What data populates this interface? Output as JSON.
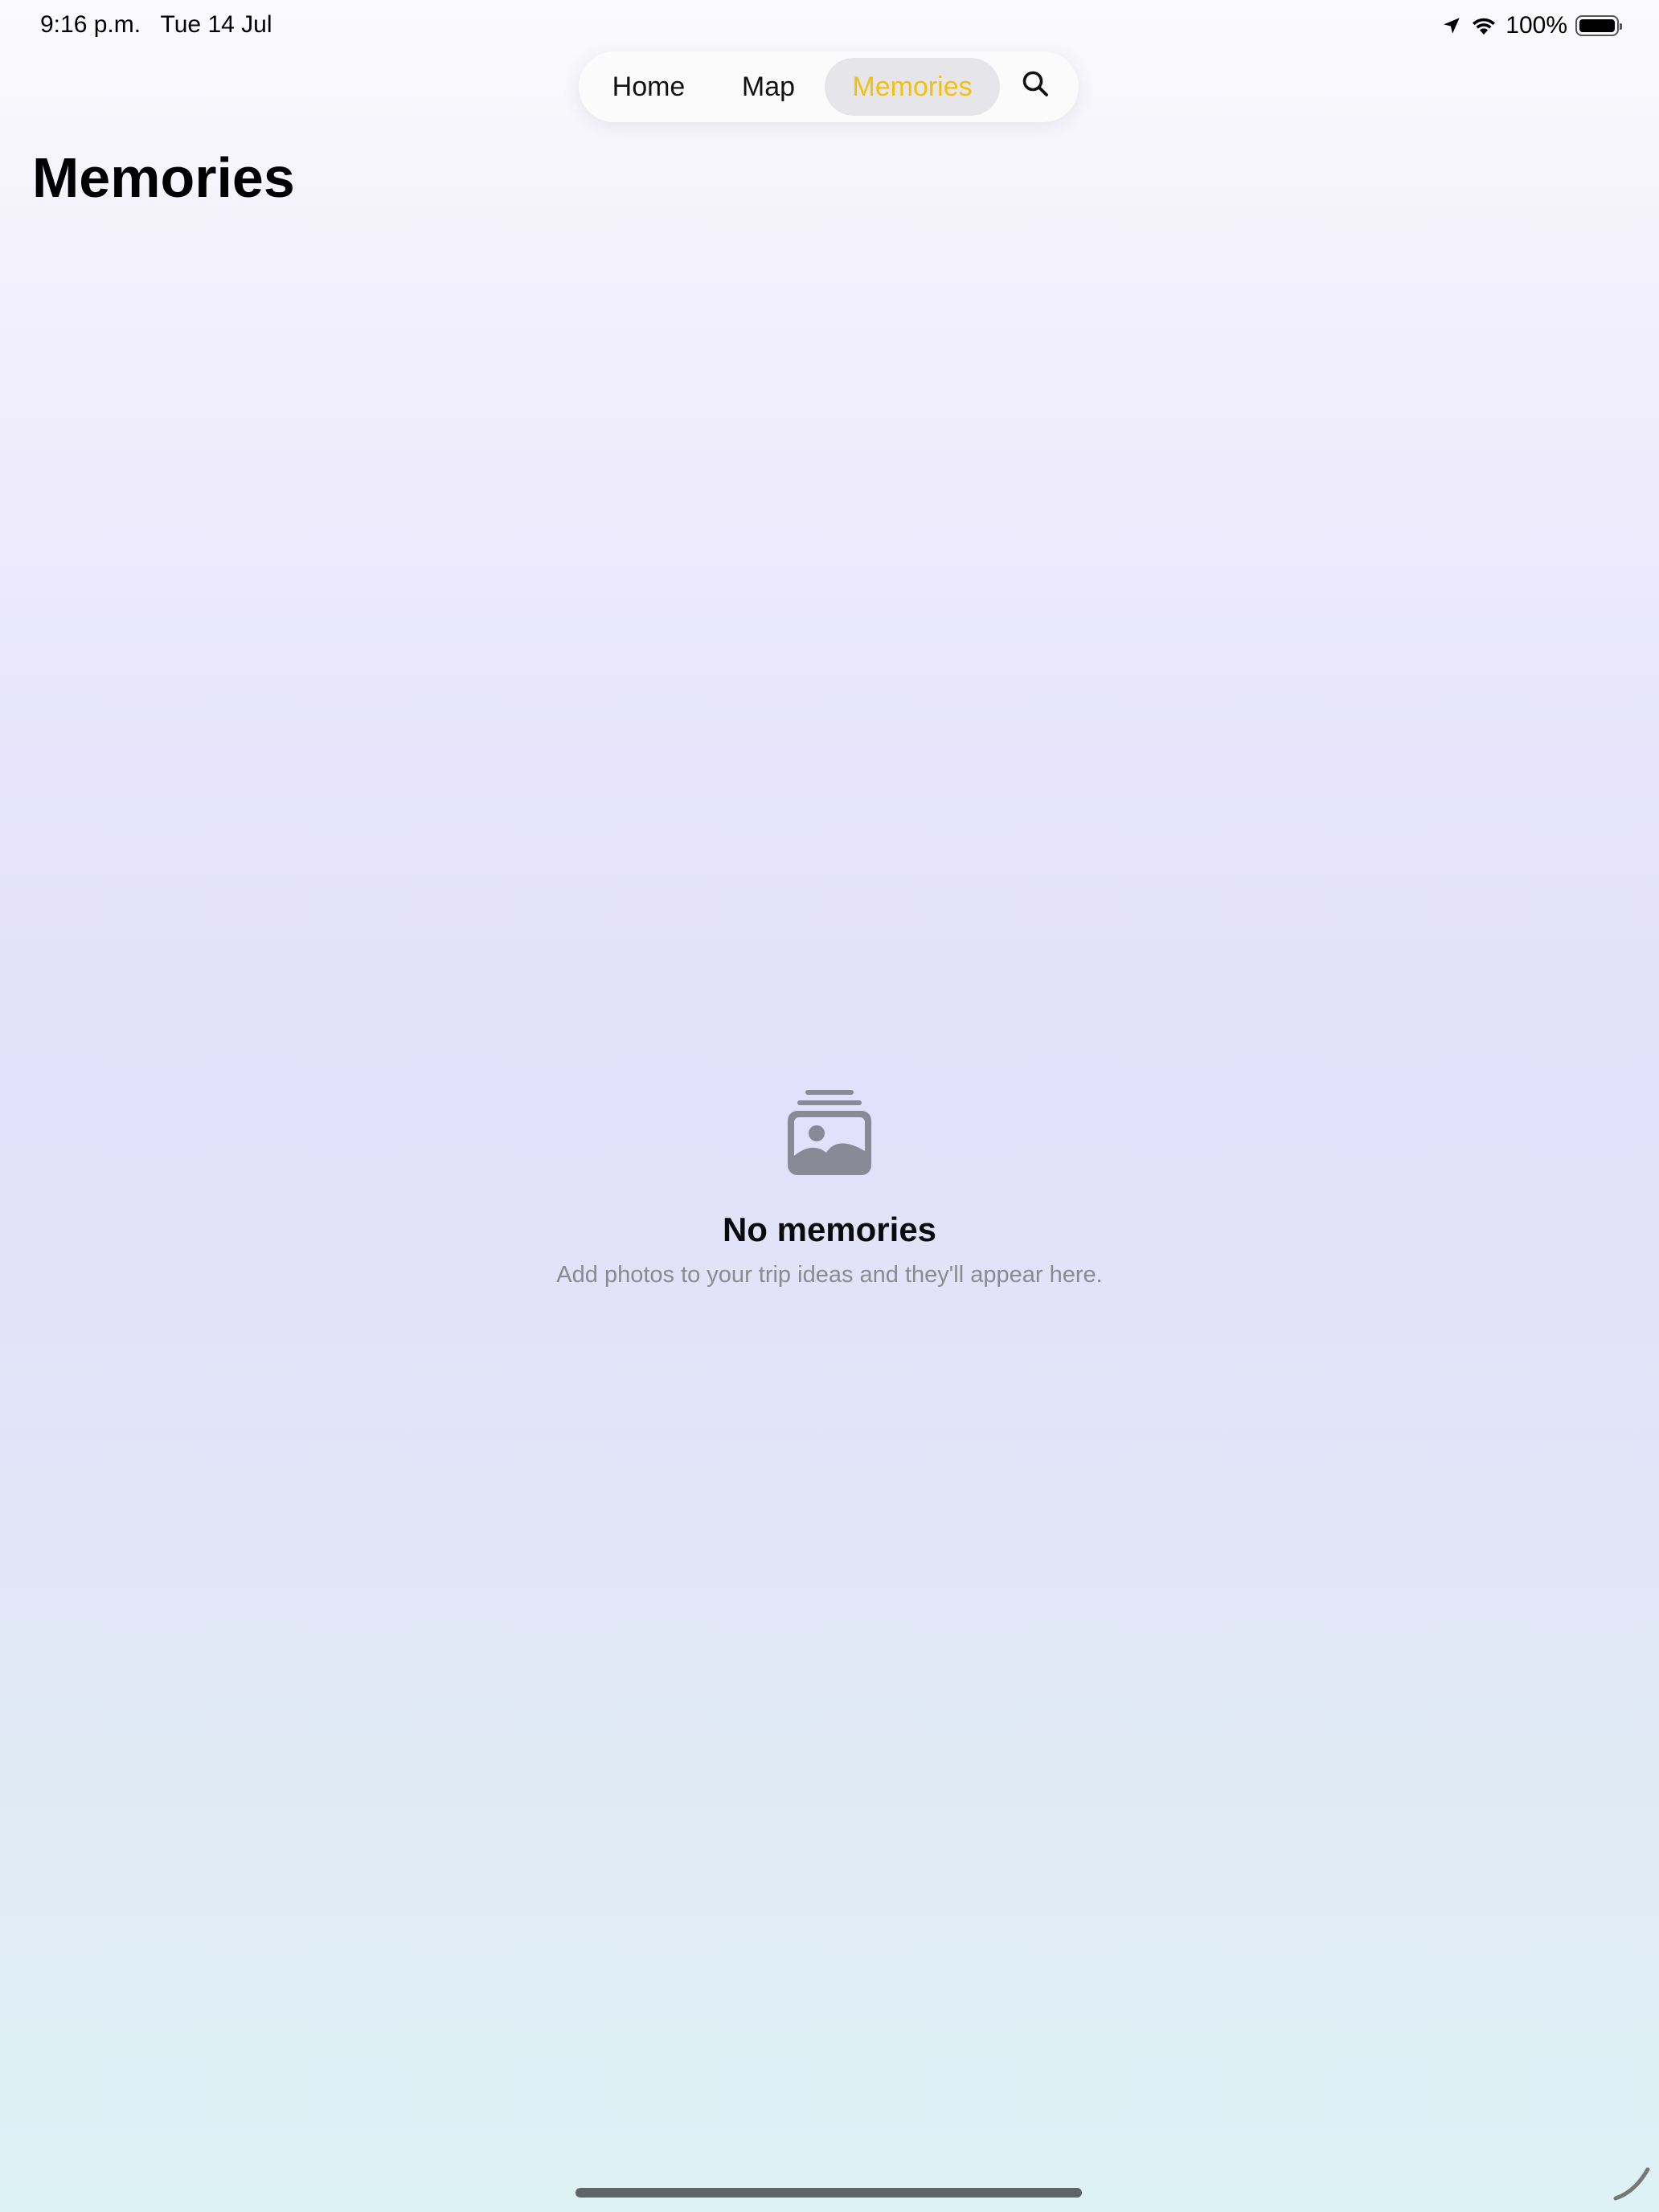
{
  "status_bar": {
    "time": "9:16 p.m.   Tue 14 Jul",
    "battery_percent": "100%",
    "icons": [
      "location-arrow-icon",
      "wifi-icon",
      "battery-icon"
    ]
  },
  "tabs": {
    "home": "Home",
    "map": "Map",
    "memories": "Memories",
    "selected": "Memories",
    "accent_color": "#f2c10f",
    "search_icon": "search-icon"
  },
  "page": {
    "title": "Memories"
  },
  "empty_state": {
    "icon": "photo-stack-icon",
    "title": "No memories",
    "subtitle": "Add photos to your trip ideas and they'll appear here."
  }
}
